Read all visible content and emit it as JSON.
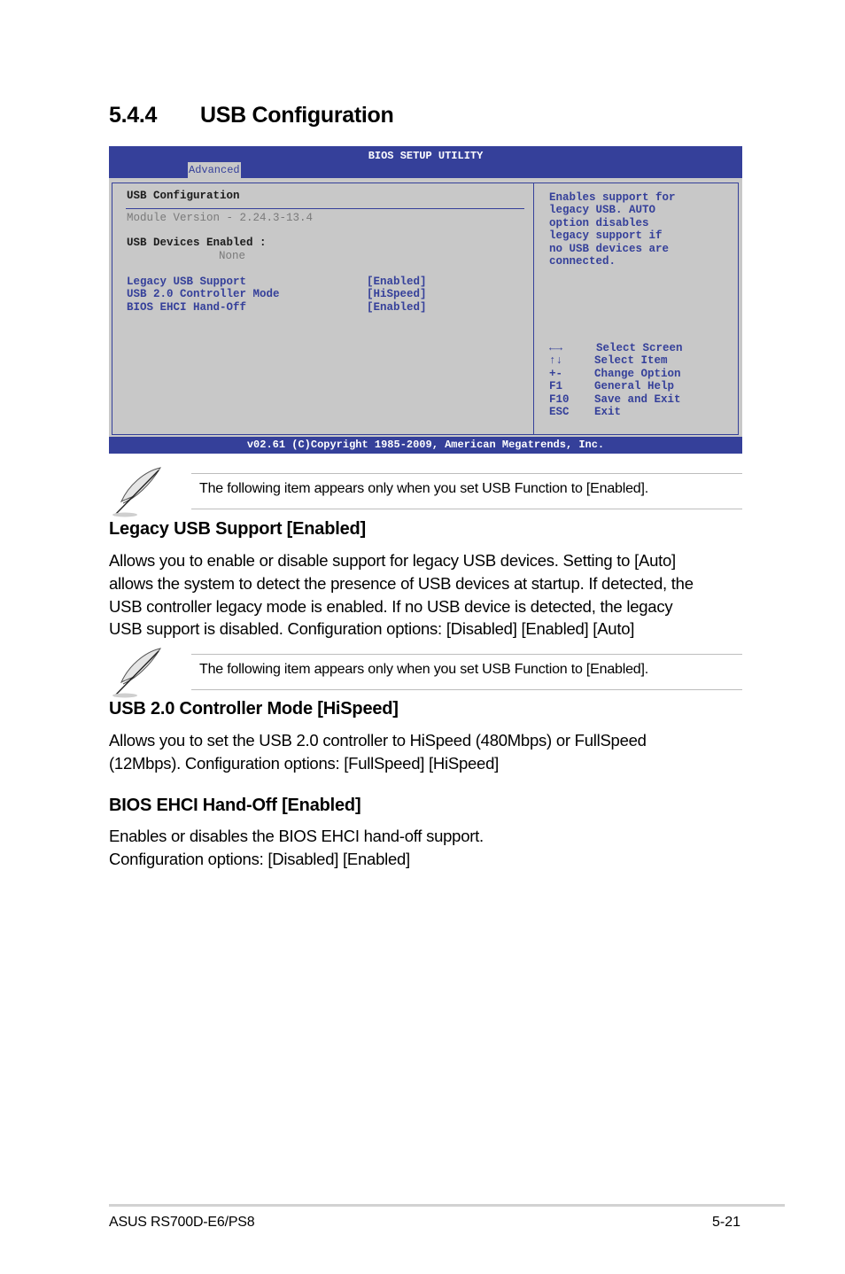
{
  "section": {
    "number": "5.4.4",
    "title": "USB Configuration"
  },
  "bios": {
    "title": "BIOS SETUP UTILITY",
    "active_tab": "Advanced",
    "main": {
      "heading": "USB Configuration",
      "module_version": "Module Version - 2.24.3-13.4",
      "devices_label": "USB Devices Enabled :",
      "devices_value": "None",
      "items": [
        {
          "label": "Legacy USB Support",
          "value": "[Enabled]"
        },
        {
          "label": "USB 2.0 Controller Mode",
          "value": "[HiSpeed]"
        },
        {
          "label": "BIOS EHCI Hand-Off",
          "value": "[Enabled]"
        }
      ]
    },
    "help_text": [
      "Enables support for",
      "legacy USB. AUTO",
      "option disables",
      "legacy support if",
      "no USB devices are",
      "connected."
    ],
    "keys": [
      {
        "key": "←→",
        "action": "Select Screen"
      },
      {
        "key": "↑↓",
        "action": "Select Item"
      },
      {
        "key": "+-",
        "action": "Change Option"
      },
      {
        "key": "F1",
        "action": "General Help"
      },
      {
        "key": "F10",
        "action": "Save and Exit"
      },
      {
        "key": "ESC",
        "action": "Exit"
      }
    ],
    "footer": "v02.61 (C)Copyright 1985-2009, American Megatrends, Inc."
  },
  "notes": [
    {
      "icon": "feather-pen-icon",
      "text": "The following item appears only when you set USB Function to [Enabled]."
    },
    {
      "icon": "feather-pen-icon",
      "text": "The following item appears only when you set USB Function to [Enabled]."
    }
  ],
  "sections": [
    {
      "heading": "Legacy USB Support [Enabled]",
      "lines": [
        "Allows you to enable or disable support for legacy USB devices. Setting to [Auto]",
        "allows the system to detect the presence of USB devices at startup. If detected, the",
        "USB controller legacy mode is enabled. If no USB device is detected, the legacy",
        "USB support is disabled. Configuration options: [Disabled] [Enabled] [Auto]"
      ]
    },
    {
      "heading": "USB 2.0 Controller Mode [HiSpeed]",
      "lines": [
        "Allows you to set the USB 2.0 controller to HiSpeed (480Mbps) or FullSpeed",
        "(12Mbps). Configuration options: [FullSpeed] [HiSpeed]"
      ]
    },
    {
      "heading": "BIOS EHCI Hand-Off [Enabled]",
      "lines": [
        "Enables or disables the BIOS EHCI hand-off support.",
        "Configuration options: [Disabled] [Enabled]"
      ]
    }
  ],
  "footer": {
    "product": "ASUS RS700D-E6/PS8",
    "page": "5-21"
  }
}
